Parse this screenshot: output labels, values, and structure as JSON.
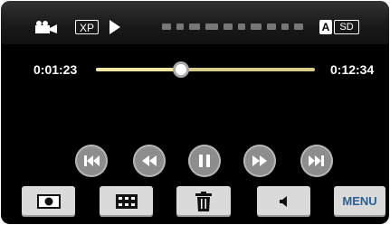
{
  "status_bar": {
    "mode_icon": "video-camera-icon",
    "quality_label": "XP",
    "playback_icon": "play-icon",
    "auto_label": "A",
    "media_label": "SD"
  },
  "playback": {
    "elapsed": "0:01:23",
    "total": "0:12:34",
    "progress": 0.39
  },
  "transport": [
    {
      "name": "skip-previous-button",
      "icon": "skip-previous-icon"
    },
    {
      "name": "rewind-button",
      "icon": "rewind-icon"
    },
    {
      "name": "pause-button",
      "icon": "pause-icon"
    },
    {
      "name": "fast-forward-button",
      "icon": "fast-forward-icon"
    },
    {
      "name": "skip-next-button",
      "icon": "skip-next-icon"
    }
  ],
  "bottom_bar": {
    "snapshot_icon": "snapshot-icon",
    "index_icon": "index-grid-icon",
    "delete_icon": "trash-icon",
    "volume_icon": "volume-icon",
    "menu_label": "MENU"
  }
}
